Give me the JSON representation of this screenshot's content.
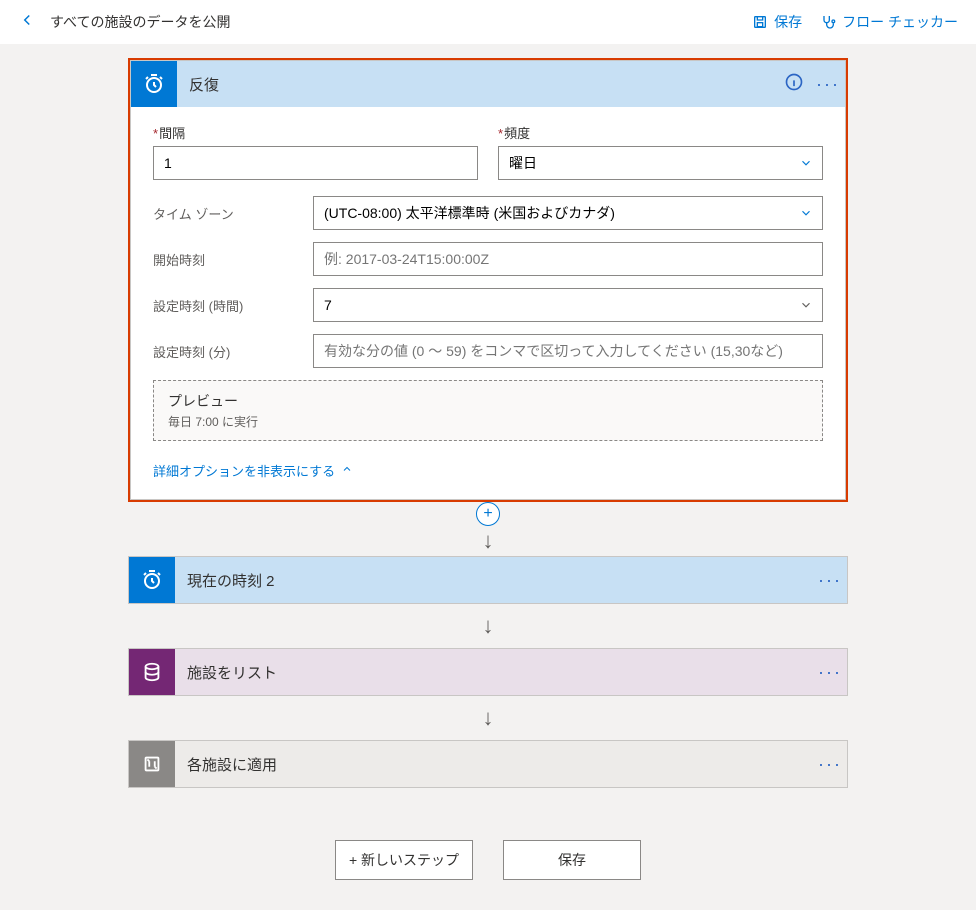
{
  "topbar": {
    "title": "すべての施設のデータを公開",
    "save": "保存",
    "checker": "フロー チェッカー"
  },
  "recurrence": {
    "title": "反復",
    "interval_label": "間隔",
    "interval_value": "1",
    "frequency_label": "頻度",
    "frequency_value": "曜日",
    "tz_label": "タイム ゾーン",
    "tz_value": "(UTC-08:00) 太平洋標準時 (米国およびカナダ)",
    "start_label": "開始時刻",
    "start_placeholder": "例: 2017-03-24T15:00:00Z",
    "hours_label": "設定時刻 (時間)",
    "hours_value": "7",
    "minutes_label": "設定時刻 (分)",
    "minutes_placeholder": "有効な分の値 (0 ～ 59) をコンマで区切って入力してください (15,30など)",
    "preview_title": "プレビュー",
    "preview_text": "毎日 7:00 に実行",
    "adv_toggle": "詳細オプションを非表示にする"
  },
  "steps": {
    "current_time": "現在の時刻 2",
    "list_facilities": "施設をリスト",
    "apply_each": "各施設に適用"
  },
  "footer": {
    "new_step": "+ 新しいステップ",
    "save": "保存"
  }
}
